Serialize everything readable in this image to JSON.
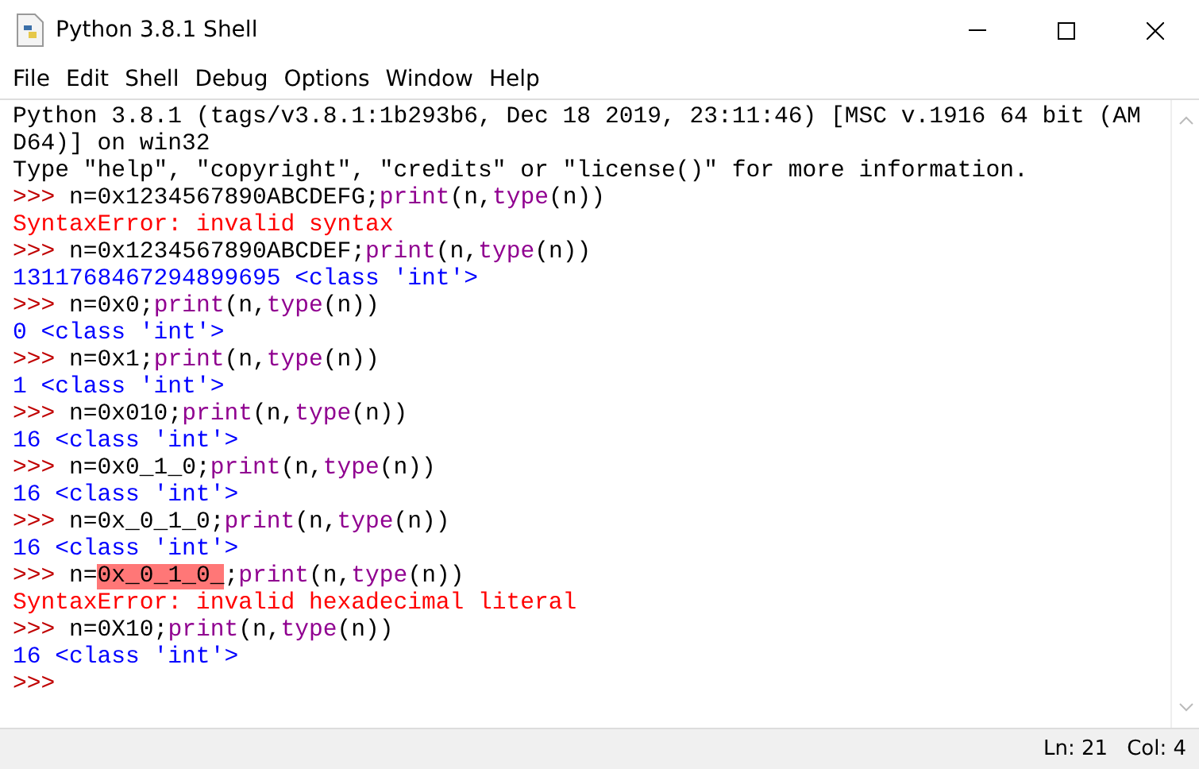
{
  "window": {
    "title": "Python 3.8.1 Shell"
  },
  "menu": [
    "File",
    "Edit",
    "Shell",
    "Debug",
    "Options",
    "Window",
    "Help"
  ],
  "shell_lines": [
    [
      {
        "kind": "banner",
        "text": "Python 3.8.1 (tags/v3.8.1:1b293b6, Dec 18 2019, 23:11:46) [MSC v.1916 64 bit (AM"
      }
    ],
    [
      {
        "kind": "banner",
        "text": "D64)] on win32"
      }
    ],
    [
      {
        "kind": "banner",
        "text": "Type \"help\", \"copyright\", \"credits\" or \"license()\" for more information."
      }
    ],
    [
      {
        "kind": "prompt",
        "text": ">>> "
      },
      {
        "kind": "code",
        "text": "n=0x1234567890ABCDEFG;"
      },
      {
        "kind": "builtin",
        "text": "print"
      },
      {
        "kind": "code",
        "text": "(n,"
      },
      {
        "kind": "builtin",
        "text": "type"
      },
      {
        "kind": "code",
        "text": "(n))"
      }
    ],
    [
      {
        "kind": "error",
        "text": "SyntaxError: invalid syntax"
      }
    ],
    [
      {
        "kind": "prompt",
        "text": ">>> "
      },
      {
        "kind": "code",
        "text": "n=0x1234567890ABCDEF;"
      },
      {
        "kind": "builtin",
        "text": "print"
      },
      {
        "kind": "code",
        "text": "(n,"
      },
      {
        "kind": "builtin",
        "text": "type"
      },
      {
        "kind": "code",
        "text": "(n))"
      }
    ],
    [
      {
        "kind": "output",
        "text": "1311768467294899695 <class 'int'>"
      }
    ],
    [
      {
        "kind": "prompt",
        "text": ">>> "
      },
      {
        "kind": "code",
        "text": "n=0x0;"
      },
      {
        "kind": "builtin",
        "text": "print"
      },
      {
        "kind": "code",
        "text": "(n,"
      },
      {
        "kind": "builtin",
        "text": "type"
      },
      {
        "kind": "code",
        "text": "(n))"
      }
    ],
    [
      {
        "kind": "output",
        "text": "0 <class 'int'>"
      }
    ],
    [
      {
        "kind": "prompt",
        "text": ">>> "
      },
      {
        "kind": "code",
        "text": "n=0x1;"
      },
      {
        "kind": "builtin",
        "text": "print"
      },
      {
        "kind": "code",
        "text": "(n,"
      },
      {
        "kind": "builtin",
        "text": "type"
      },
      {
        "kind": "code",
        "text": "(n))"
      }
    ],
    [
      {
        "kind": "output",
        "text": "1 <class 'int'>"
      }
    ],
    [
      {
        "kind": "prompt",
        "text": ">>> "
      },
      {
        "kind": "code",
        "text": "n=0x010;"
      },
      {
        "kind": "builtin",
        "text": "print"
      },
      {
        "kind": "code",
        "text": "(n,"
      },
      {
        "kind": "builtin",
        "text": "type"
      },
      {
        "kind": "code",
        "text": "(n))"
      }
    ],
    [
      {
        "kind": "output",
        "text": "16 <class 'int'>"
      }
    ],
    [
      {
        "kind": "prompt",
        "text": ">>> "
      },
      {
        "kind": "code",
        "text": "n=0x0_1_0;"
      },
      {
        "kind": "builtin",
        "text": "print"
      },
      {
        "kind": "code",
        "text": "(n,"
      },
      {
        "kind": "builtin",
        "text": "type"
      },
      {
        "kind": "code",
        "text": "(n))"
      }
    ],
    [
      {
        "kind": "output",
        "text": "16 <class 'int'>"
      }
    ],
    [
      {
        "kind": "prompt",
        "text": ">>> "
      },
      {
        "kind": "code",
        "text": "n=0x_0_1_0;"
      },
      {
        "kind": "builtin",
        "text": "print"
      },
      {
        "kind": "code",
        "text": "(n,"
      },
      {
        "kind": "builtin",
        "text": "type"
      },
      {
        "kind": "code",
        "text": "(n))"
      }
    ],
    [
      {
        "kind": "output",
        "text": "16 <class 'int'>"
      }
    ],
    [
      {
        "kind": "prompt",
        "text": ">>> "
      },
      {
        "kind": "code",
        "text": "n="
      },
      {
        "kind": "highlight",
        "text": "0x_0_1_0_"
      },
      {
        "kind": "code",
        "text": ";"
      },
      {
        "kind": "builtin",
        "text": "print"
      },
      {
        "kind": "code",
        "text": "(n,"
      },
      {
        "kind": "builtin",
        "text": "type"
      },
      {
        "kind": "code",
        "text": "(n))"
      }
    ],
    [
      {
        "kind": "error",
        "text": "SyntaxError: invalid hexadecimal literal"
      }
    ],
    [
      {
        "kind": "prompt",
        "text": ">>> "
      },
      {
        "kind": "code",
        "text": "n=0X10;"
      },
      {
        "kind": "builtin",
        "text": "print"
      },
      {
        "kind": "code",
        "text": "(n,"
      },
      {
        "kind": "builtin",
        "text": "type"
      },
      {
        "kind": "code",
        "text": "(n))"
      }
    ],
    [
      {
        "kind": "output",
        "text": "16 <class 'int'>"
      }
    ],
    [
      {
        "kind": "prompt",
        "text": ">>>"
      }
    ]
  ],
  "status_bar": {
    "line": "Ln: 21",
    "column": "Col: 4"
  }
}
